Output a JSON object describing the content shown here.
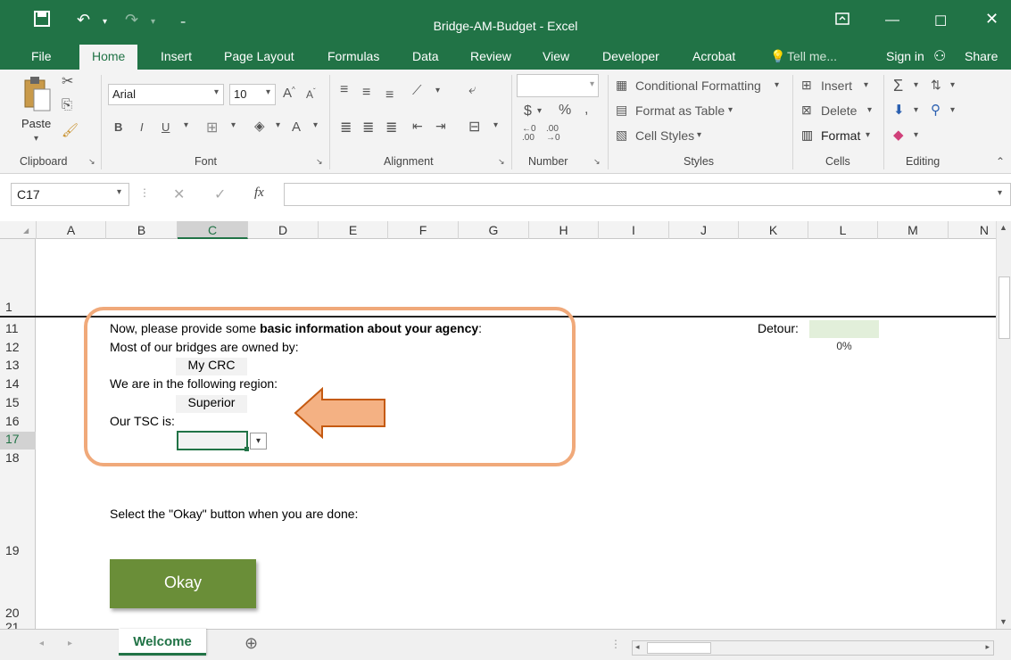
{
  "window": {
    "title": "Bridge-AM-Budget - Excel"
  },
  "ribbon_tabs": [
    "File",
    "Home",
    "Insert",
    "Page Layout",
    "Formulas",
    "Data",
    "Review",
    "View",
    "Developer",
    "Acrobat",
    "Tell me...",
    "Sign in",
    "Share"
  ],
  "ribbon": {
    "paste_label": "Paste",
    "font_name": "Arial",
    "font_size": "10",
    "conditional_formatting": "Conditional Formatting",
    "format_as_table": "Format as Table",
    "cell_styles": "Cell Styles",
    "insert": "Insert",
    "delete": "Delete",
    "format": "Format",
    "groups": [
      "Clipboard",
      "Font",
      "Alignment",
      "Number",
      "Styles",
      "Cells",
      "Editing"
    ]
  },
  "formula_bar": {
    "name_box": "C17",
    "fx": "fx",
    "value": ""
  },
  "columns": [
    "A",
    "B",
    "C",
    "D",
    "E",
    "F",
    "G",
    "H",
    "I",
    "J",
    "K",
    "L",
    "M",
    "N"
  ],
  "selected_column": "C",
  "rows": [
    "1",
    "11",
    "12",
    "13",
    "14",
    "15",
    "16",
    "17",
    "18",
    "19",
    "20",
    "21"
  ],
  "selected_row": "17",
  "sheet": {
    "intro_prefix": "Now, please provide some ",
    "intro_bold": "basic information about your agency",
    "intro_suffix": ":",
    "owned_by_label": "Most of our bridges are owned by:",
    "owned_by_value": "My CRC",
    "region_label": "We are in the following region:",
    "region_value": "Superior",
    "tsc_label": "Our TSC is:",
    "tsc_value": "",
    "detour_label": "Detour:",
    "detour_percent": "0%",
    "select_prompt": "Select the \"Okay\" button when you are done:",
    "okay_button": "Okay"
  },
  "sheet_tabs": [
    "Welcome"
  ],
  "active_sheet": "Welcome",
  "colors": {
    "excel_green": "#217346",
    "okay_green": "#6a8e38",
    "callout_orange": "#f0a97a",
    "detour_fill": "#e2efda"
  }
}
